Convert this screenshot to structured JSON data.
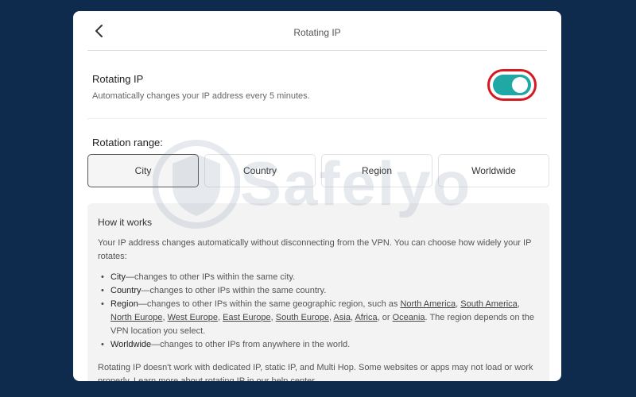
{
  "header": {
    "title": "Rotating IP",
    "back_icon": "chevron-left-icon"
  },
  "setting": {
    "title": "Rotating IP",
    "description": "Automatically changes your IP address every 5 minutes.",
    "enabled": true,
    "toggle_color": "#1fa8a4",
    "highlight_color": "#d71920"
  },
  "rotation": {
    "label": "Rotation range:",
    "options": [
      "City",
      "Country",
      "Region",
      "Worldwide"
    ],
    "selected": "City"
  },
  "info": {
    "title": "How it works",
    "intro": "Your IP address changes automatically without disconnecting from the VPN. You can choose how widely your IP rotates:",
    "city_term": "City",
    "city_text": "—changes to other IPs within the same city.",
    "country_term": "Country",
    "country_text": "—changes to other IPs within the same country.",
    "region_term": "Region",
    "region_text": "—changes to other IPs within the same geographic region, such as ",
    "regions": [
      "North America",
      "South America",
      "North Europe",
      "West Europe",
      "East Europe",
      "South Europe",
      "Asia",
      "Africa",
      "Oceania"
    ],
    "region_or": "or ",
    "region_suffix": ". The region depends on the VPN location you select.",
    "worldwide_term": "Worldwide",
    "worldwide_text": "—changes to other IPs from anywhere in the world.",
    "footer": "Rotating IP doesn't work with dedicated IP, static IP, and Multi Hop. Some websites or apps may not load or work properly. Learn more about rotating IP in our help center."
  },
  "watermark": {
    "text": "Safelyo"
  }
}
